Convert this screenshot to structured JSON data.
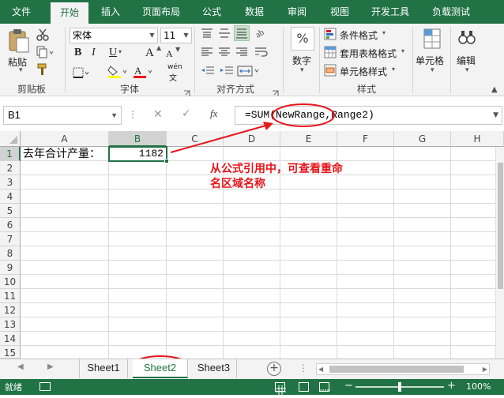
{
  "ribbon": {
    "tabs": [
      {
        "label": "文件"
      },
      {
        "label": "开始"
      },
      {
        "label": "插入"
      },
      {
        "label": "页面布局"
      },
      {
        "label": "公式"
      },
      {
        "label": "数据"
      },
      {
        "label": "审阅"
      },
      {
        "label": "视图"
      },
      {
        "label": "开发工具"
      },
      {
        "label": "负载测试"
      }
    ],
    "active_tab": "开始",
    "clipboard": {
      "paste_label": "粘贴",
      "group_label": "剪贴板"
    },
    "font": {
      "font_name": "宋体",
      "font_size": "11",
      "group_label": "字体",
      "bold": "B",
      "italic": "I",
      "underline": "U",
      "phonetic": "wén",
      "grow": "A",
      "shrink": "A"
    },
    "alignment": {
      "group_label": "对齐方式"
    },
    "number": {
      "label": "数字",
      "symbol": "%"
    },
    "styles": {
      "conditional": "条件格式",
      "table": "套用表格格式",
      "cell": "单元格样式",
      "group_label": "样式"
    },
    "cells": {
      "label": "单元格"
    },
    "editing": {
      "label": "编辑"
    }
  },
  "formula_bar": {
    "name_box": "B1",
    "fx": "fx",
    "formula": "=SUM(NewRange,Range2)"
  },
  "grid": {
    "columns": [
      "A",
      "B",
      "C",
      "D",
      "E",
      "F",
      "G",
      "H"
    ],
    "rows": [
      "1",
      "2",
      "3",
      "4",
      "5",
      "6",
      "7",
      "8",
      "9",
      "10",
      "11",
      "12",
      "13",
      "14",
      "15"
    ],
    "a1": "去年合计产量：",
    "b1": "1182"
  },
  "annotation": {
    "text_line1": "从公式引用中，可查看重命",
    "text_line2": "名区域名称",
    "color": "#e8151b"
  },
  "sheets": {
    "tabs": [
      "Sheet1",
      "Sheet2",
      "Sheet3"
    ],
    "active": "Sheet2"
  },
  "status": {
    "ready": "就绪",
    "zoom": "100%"
  },
  "colors": {
    "brand": "#217346"
  }
}
